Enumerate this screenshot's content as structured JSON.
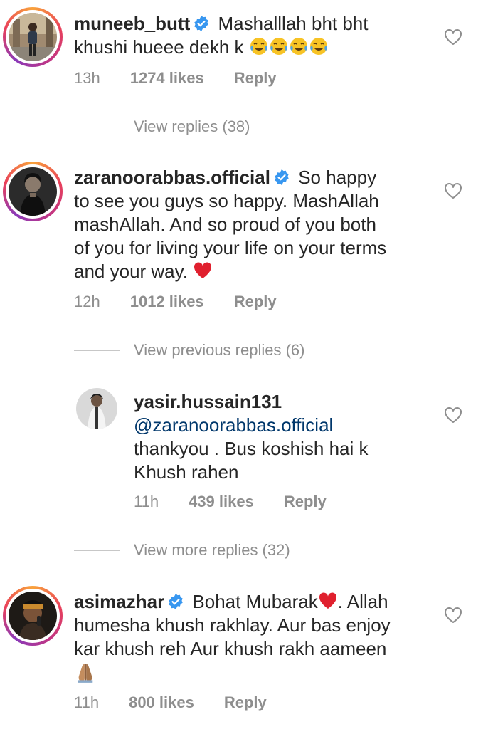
{
  "comments": [
    {
      "username": "muneeb_butt",
      "text_line1": "Mashalllah bht bht",
      "text_line2": "khushi hueee dekh k",
      "time": "13h",
      "likes": "1274 likes",
      "reply": "Reply",
      "view_replies": "View replies (38)"
    },
    {
      "username": "zaranoorabbas.official",
      "text_line1": "So happy",
      "text_line2": "to see you guys so happy. MashAllah",
      "text_line3": "mashAllah. And so proud of you both",
      "text_line4": "of you for living your life on your terms",
      "text_line5": "and your way.",
      "time": "12h",
      "likes": "1012 likes",
      "reply": "Reply",
      "view_replies": "View previous replies (6)"
    },
    {
      "username": "yasir.hussain131",
      "mention": "@zaranoorabbas.official",
      "text_line1": "thankyou . Bus koshish hai k",
      "text_line2": "Khush rahen",
      "time": "11h",
      "likes": "439 likes",
      "reply": "Reply",
      "view_replies": "View more replies (32)"
    },
    {
      "username": "asimazhar",
      "text_line1a": "Bohat Mubarak",
      "text_line1b": ". Allah",
      "text_line2": "humesha khush rakhlay. Aur bas enjoy",
      "text_line3": "kar khush reh Aur khush rakh aameen",
      "time": "11h",
      "likes": "800 likes",
      "reply": "Reply"
    }
  ],
  "colors": {
    "text": "#262626",
    "meta": "#8e8e8e",
    "verified": "#3897f0",
    "mention": "#00376b",
    "heart_emoji": "#e0202e"
  },
  "icons": {
    "heart_outline": "heart-outline-icon",
    "verified": "verified-badge-icon",
    "laugh_emoji": "tears-of-joy-emoji",
    "red_heart_emoji": "red-heart-emoji",
    "folded_hands_emoji": "folded-hands-emoji"
  }
}
